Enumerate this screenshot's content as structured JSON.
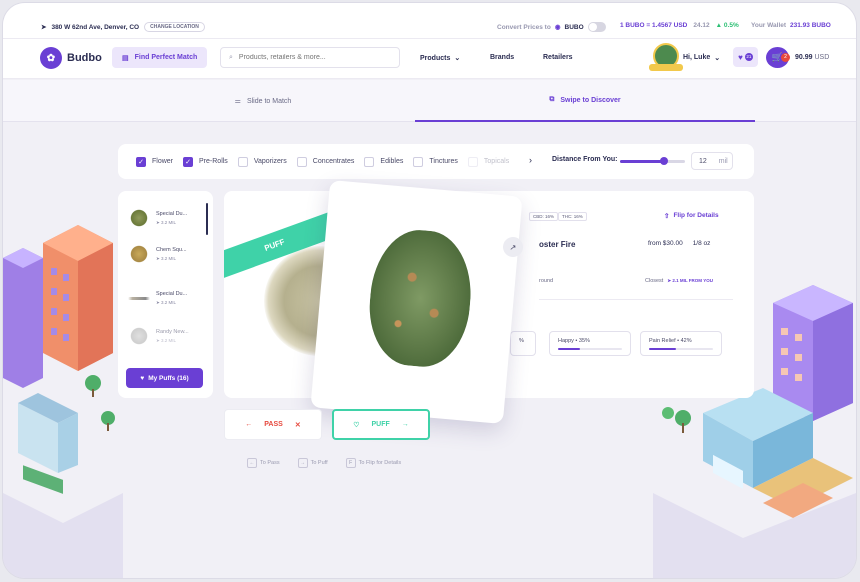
{
  "topbar": {
    "location": "380 W 62nd Ave, Denver, CO",
    "change_location": "CHANGE LOCATION",
    "convert_label": "Convert Prices to",
    "convert_currency": "BUBO",
    "rate": "1 BUBO = 1.4567 USD",
    "price": "24.12",
    "change": "▲ 0.5%",
    "wallet_label": "Your Wallet",
    "wallet_value": "231.93 BUBO"
  },
  "header": {
    "brand": "Budbo",
    "find_match": "Find Perfect Match",
    "search_placeholder": "Products, retailers & more...",
    "nav": [
      "Products",
      "Brands",
      "Retailers"
    ],
    "greeting": "Hi, Luke",
    "favorites_count": "21",
    "cart_count": "2",
    "balance": "90.99",
    "balance_unit": "USD"
  },
  "modes": {
    "slide": "Slide to Match",
    "swipe": "Swipe to Discover"
  },
  "filters": {
    "items": [
      {
        "label": "Flower",
        "checked": true
      },
      {
        "label": "Pre-Rolls",
        "checked": true
      },
      {
        "label": "Vaporizers",
        "checked": false
      },
      {
        "label": "Concentrates",
        "checked": false
      },
      {
        "label": "Edibles",
        "checked": false
      },
      {
        "label": "Tinctures",
        "checked": false
      },
      {
        "label": "Topicals",
        "checked": false
      }
    ],
    "distance_label": "Distance From You:",
    "distance_value": "12",
    "distance_unit": "mil",
    "distance_fraction": 0.68
  },
  "puffs": {
    "items": [
      {
        "name": "Special Du...",
        "dist": "3.2 MIL"
      },
      {
        "name": "Chem Squ...",
        "dist": "3.2 MIL"
      },
      {
        "name": "Special Du...",
        "dist": "3.2 MIL"
      },
      {
        "name": "Randy New...",
        "dist": "3.2 MIL"
      }
    ],
    "my_puffs": "My Puffs (16)"
  },
  "card": {
    "ribbon": "PUFF",
    "tags": [
      "CBD: 16%",
      "THC: 16%"
    ],
    "flip": "Flip for Details",
    "name": "oster Fire",
    "price": "from $30.00",
    "size": "1/8 oz",
    "shop": "round",
    "closest_label": "Closest",
    "closest_value": "2.1 MIL FROM YOU",
    "effects": [
      {
        "label": "%",
        "value": 0.3
      },
      {
        "label": "Happy • 35%",
        "value": 0.35
      },
      {
        "label": "Pain Relief • 42%",
        "value": 0.42
      }
    ]
  },
  "actions": {
    "pass": "PASS",
    "puff": "PUFF"
  },
  "hints": [
    {
      "key": "←",
      "text": "To Pass"
    },
    {
      "key": "→",
      "text": "To Puff"
    },
    {
      "key": "F",
      "text": "To Flip for Details"
    }
  ],
  "colors": {
    "accent": "#6a3fd4",
    "puff": "#3fd2a8",
    "pass": "#e6483d"
  }
}
